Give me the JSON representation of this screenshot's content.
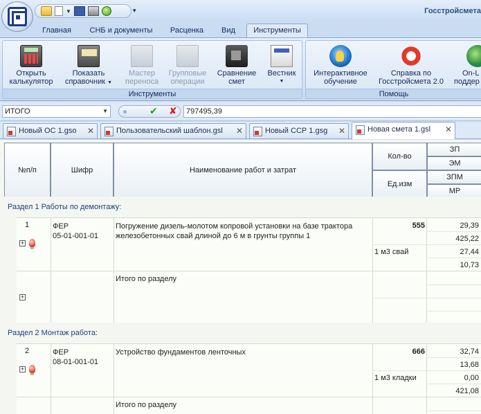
{
  "window": {
    "title": "Госстройсмета"
  },
  "ribbon_tabs": [
    "Главная",
    "СНБ и документы",
    "Расценка",
    "Вид",
    "Инструменты"
  ],
  "ribbon_groups": {
    "tools": {
      "label": "Инструменты",
      "buttons": {
        "calc": {
          "line1": "Открыть",
          "line2": "калькулятор"
        },
        "ref": {
          "line1": "Показать",
          "line2": "справочник"
        },
        "transfer": {
          "line1": "Мастер",
          "line2": "переноса"
        },
        "group": {
          "line1": "Групповые",
          "line2": "операции"
        },
        "compare": {
          "line1": "Сравнение",
          "line2": "смет"
        },
        "vestnik": {
          "line1": "Вестник",
          "line2": ""
        }
      }
    },
    "help": {
      "label": "Помощь",
      "buttons": {
        "interactive": {
          "line1": "Интерактивное",
          "line2": "обучение"
        },
        "reference": {
          "line1": "Справка по",
          "line2": "Госстройсмета 2.0"
        },
        "online": {
          "line1": "On-L",
          "line2": "поддер"
        }
      }
    }
  },
  "formula_bar": {
    "name": "ИТОГО",
    "value": "797495,39"
  },
  "doc_tabs": [
    "Новый ОС 1.gso",
    "Пользовательский шаблон.gsl",
    "Новый ССР 1.gsg",
    "Новая смета 1.gsl"
  ],
  "table_header": {
    "npp": "№п/п",
    "code": "Шифр",
    "name": "Наименование работ и затрат",
    "qty": "Кол-во",
    "unit": "Ед.изм",
    "zp": "ЗП",
    "em": "ЭМ",
    "zpm": "ЗПМ",
    "mr": "МР"
  },
  "sections": [
    {
      "title": "Раздел   1 Работы по демонтажу:",
      "item": {
        "num": "1",
        "code1": "ФЕР",
        "code2": "05-01-001-01",
        "name": "Погружение дизель-молотом копровой установки на базе трактора железобетонных свай длиной до 6 м в грунты группы 1",
        "qty": "555",
        "unit": "1 м3 свай",
        "values": [
          "29,39",
          "425,22",
          "27,44",
          "10,73"
        ]
      },
      "subtotal": "Итого по разделу"
    },
    {
      "title": "Раздел   2 Монтаж работа:",
      "item": {
        "num": "2",
        "code1": "ФЕР",
        "code2": "08-01-001-01",
        "name": "Устройство фундаментов ленточных",
        "qty": "666",
        "unit": "1 м3 кладки",
        "values": [
          "32,74",
          "13,68",
          "0,00",
          "421,08"
        ]
      },
      "subtotal": "Итого по разделу"
    }
  ]
}
